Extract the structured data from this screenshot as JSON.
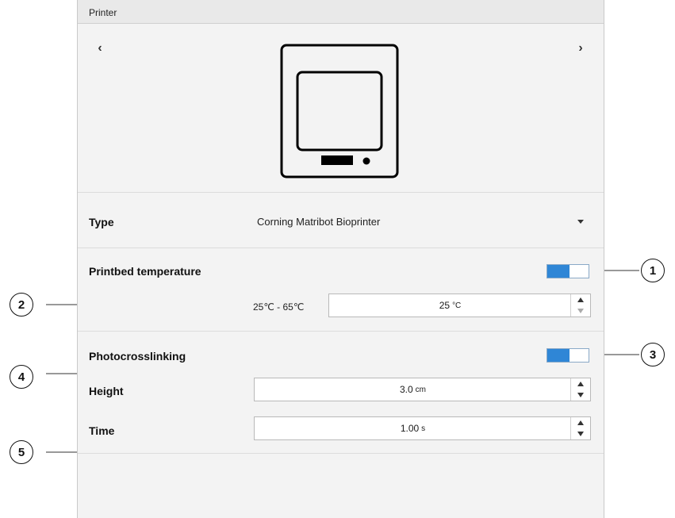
{
  "panel": {
    "title": "Printer",
    "prev_arrow": "‹",
    "next_arrow": "›",
    "printer_icon": "printer-device-icon"
  },
  "type_row": {
    "label": "Type",
    "selected_value": "Corning Matribot Bioprinter",
    "dropdown_icon": "dropdown-arrow-icon"
  },
  "printbed": {
    "label": "Printbed temperature",
    "toggle_on": true,
    "range_text": "25℃ - 65℃",
    "value": "25",
    "unit": "°C"
  },
  "photocrosslinking": {
    "label": "Photocrosslinking",
    "toggle_on": true,
    "height_label": "Height",
    "height_value": "3.0",
    "height_unit": "cm",
    "time_label": "Time",
    "time_value": "1.00",
    "time_unit": "s"
  },
  "callouts": [
    "1",
    "2",
    "3",
    "4",
    "5"
  ],
  "colors": {
    "toggle_accent": "#2f86d6",
    "panel_bg": "#f3f3f3",
    "titlebar_bg": "#e9e9e9"
  }
}
